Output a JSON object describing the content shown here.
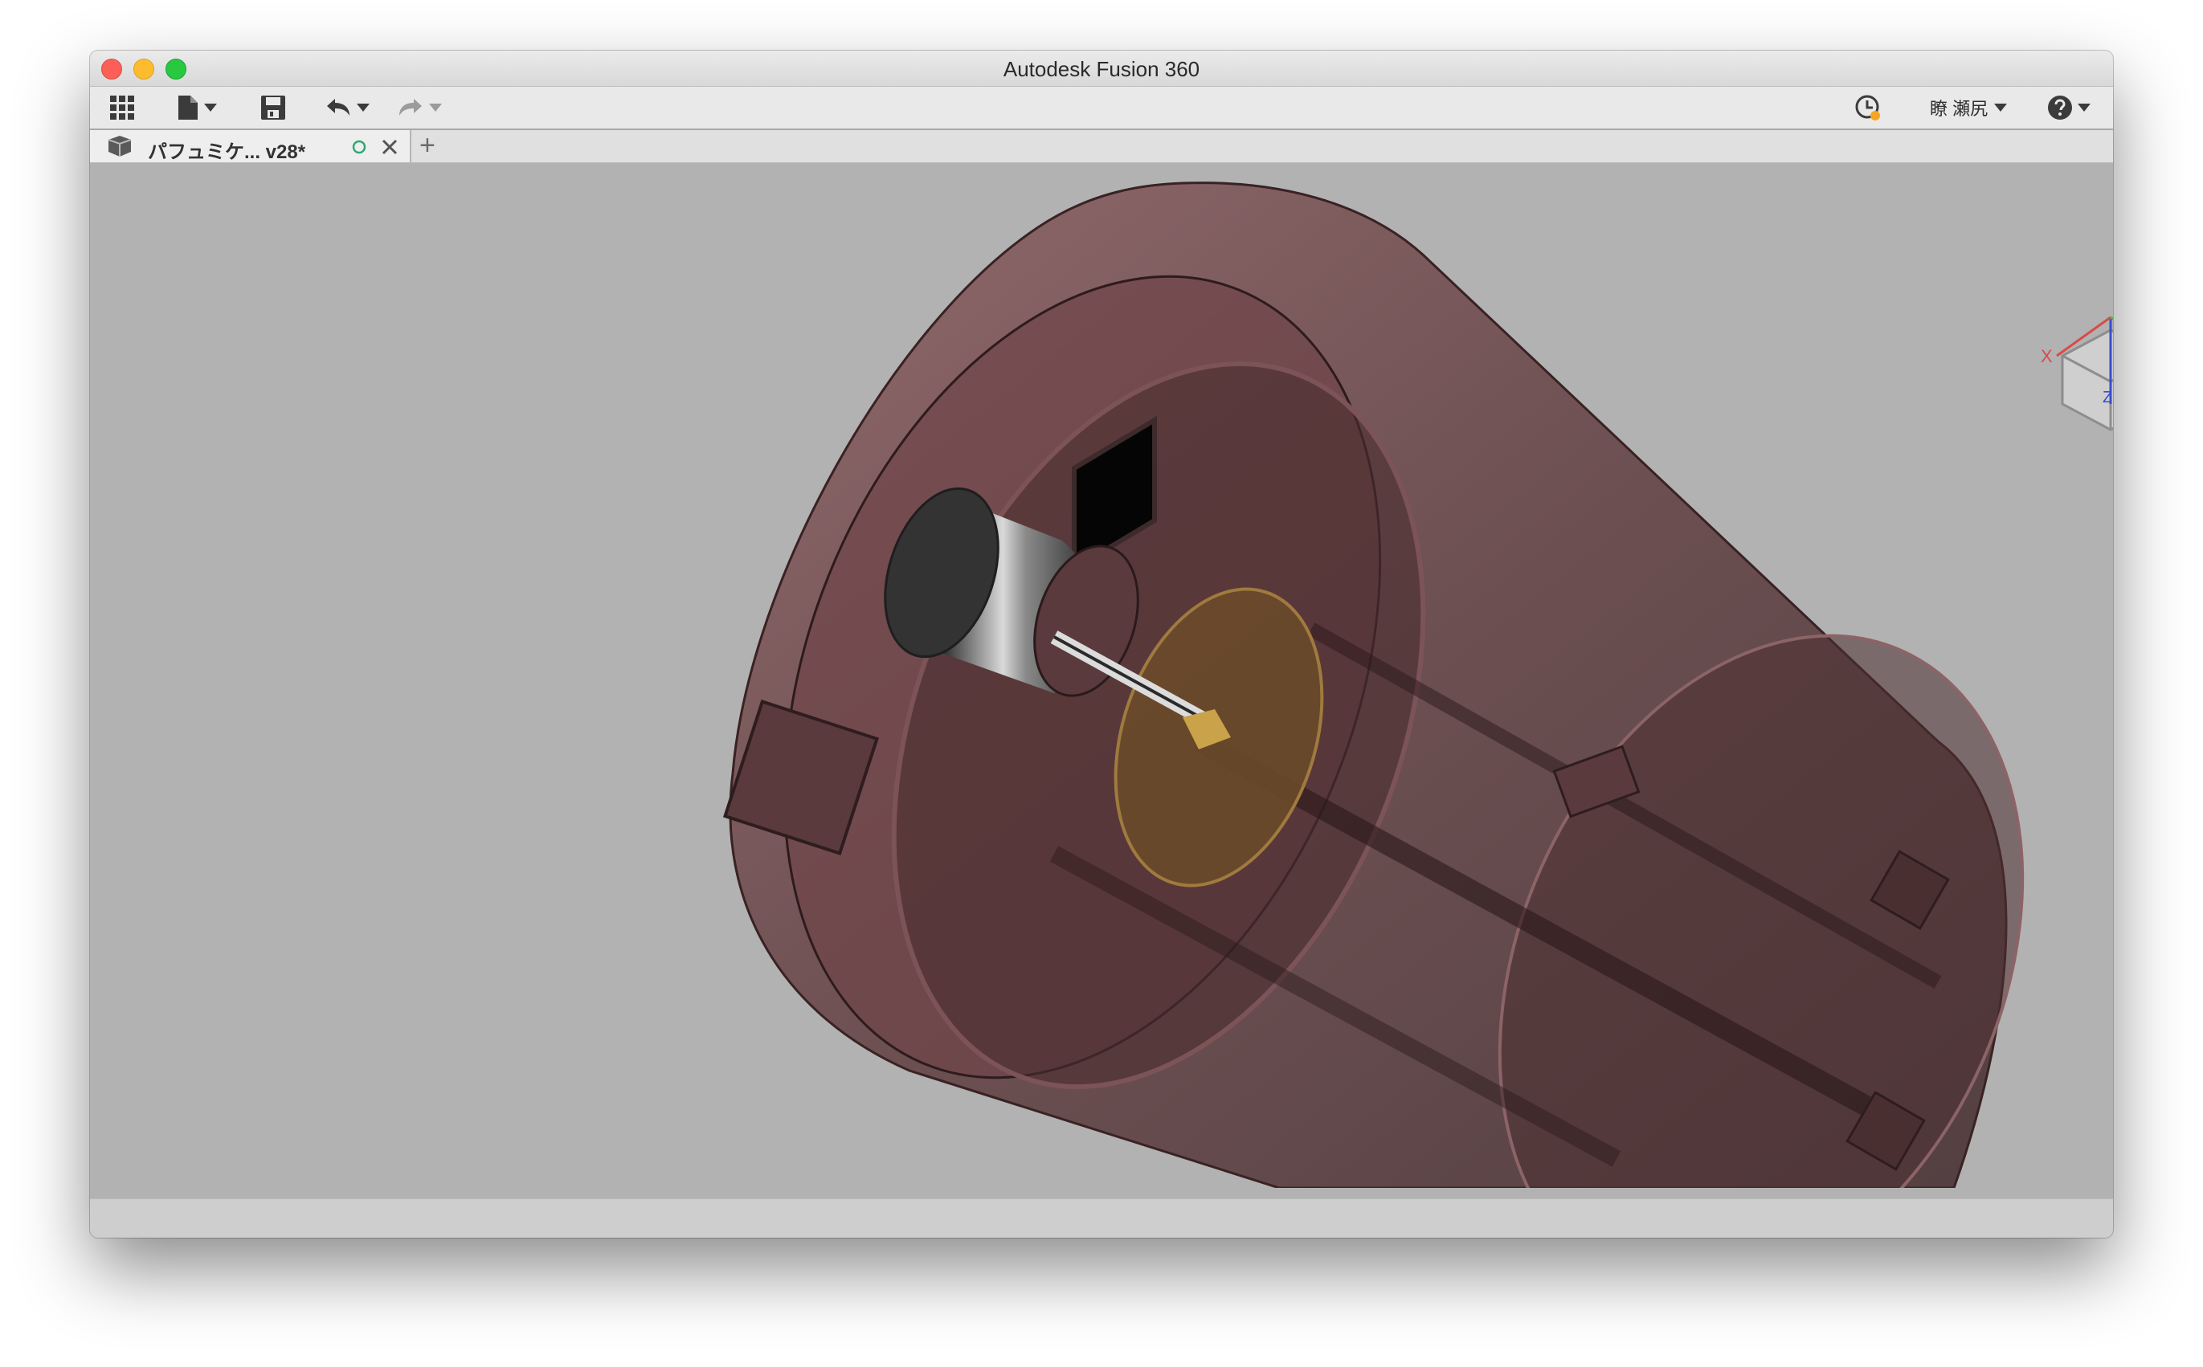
{
  "window": {
    "title": "Autodesk Fusion 360"
  },
  "toolbar": {
    "icons": [
      "app-grid-icon",
      "file-icon",
      "save-icon",
      "undo-icon",
      "redo-icon",
      "job-status-icon",
      "help-icon"
    ],
    "user_label": "瞭 瀬尻"
  },
  "tab": {
    "label": "パフュミケ... v28*",
    "status_color": "#2fa873",
    "add_symbol": "+"
  },
  "viewcube": {
    "x_label": "X",
    "z_label": "Z"
  },
  "colors": {
    "viewport_bg": "#b2b2b2",
    "body_tint": "#6b3a3d"
  }
}
